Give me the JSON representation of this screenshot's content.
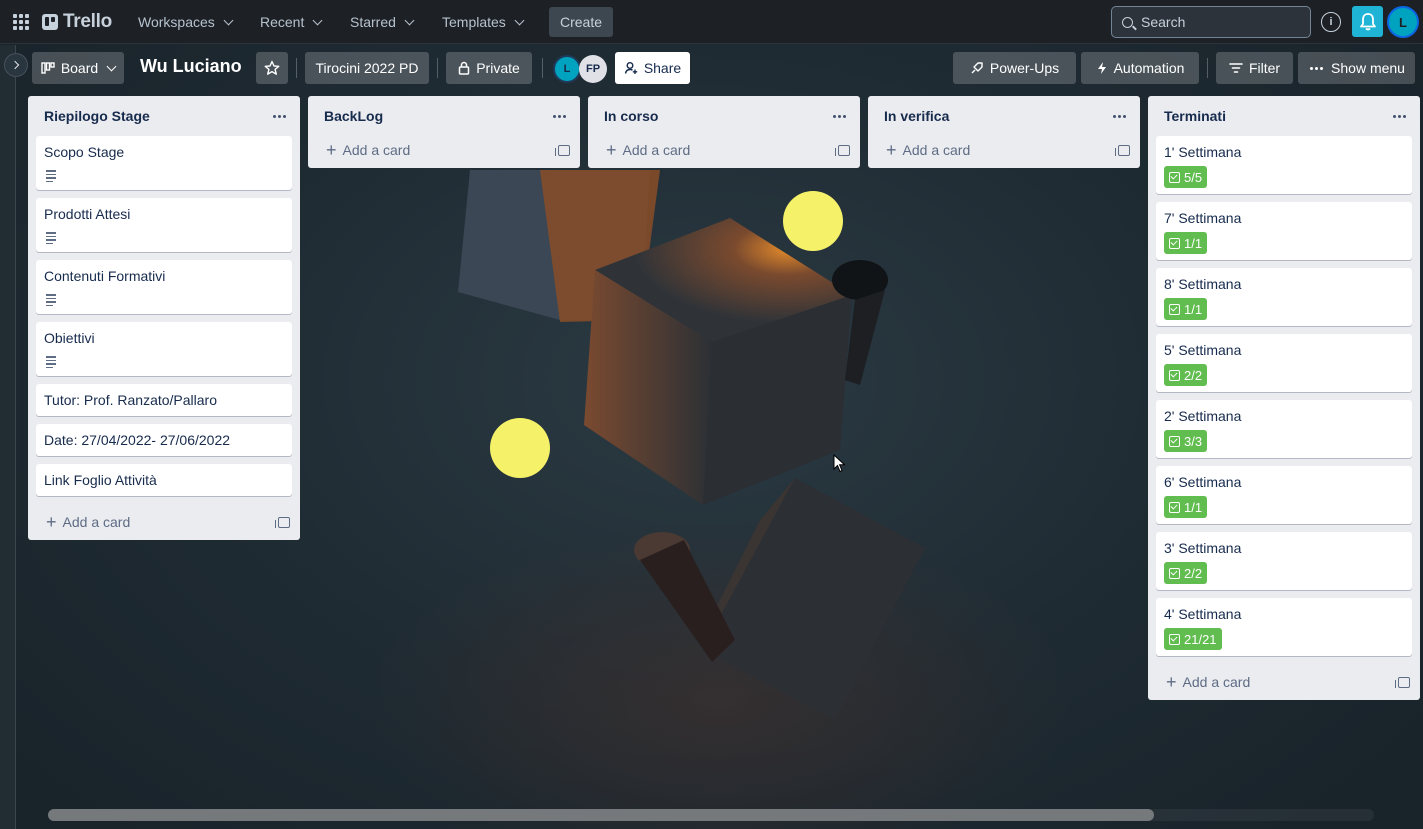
{
  "topnav": {
    "brand": "Trello",
    "menus": [
      "Workspaces",
      "Recent",
      "Starred",
      "Templates"
    ],
    "create_label": "Create",
    "search_placeholder": "Search",
    "info_glyph": "i",
    "avatar_initial": "L",
    "icons": [
      "apps-grid-icon",
      "trello-logo-icon",
      "search-icon",
      "info-icon",
      "bell-icon"
    ]
  },
  "board": {
    "view_label": "Board",
    "title": "Wu Luciano",
    "workspace_label": "Tirocini 2022 PD",
    "visibility_label": "Private",
    "members": [
      {
        "initials": "L",
        "color": "#00a3bf"
      },
      {
        "initials": "FP",
        "color": "#dfe1e6"
      }
    ],
    "share_label": "Share",
    "powerups_label": "Power-Ups",
    "automation_label": "Automation",
    "filter_label": "Filter",
    "show_menu_label": "Show menu"
  },
  "lists": [
    {
      "title": "Riepilogo Stage",
      "cards": [
        {
          "title": "Scopo Stage",
          "has_description": true
        },
        {
          "title": "Prodotti Attesi",
          "has_description": true
        },
        {
          "title": "Contenuti Formativi",
          "has_description": true
        },
        {
          "title": "Obiettivi",
          "has_description": true
        },
        {
          "title": "Tutor: Prof. Ranzato/Pallaro"
        },
        {
          "title": "Date: 27/04/2022- 27/06/2022"
        },
        {
          "title": "Link Foglio Attività"
        }
      ],
      "add_label": "Add a card"
    },
    {
      "title": "BackLog",
      "cards": [],
      "add_label": "Add a card"
    },
    {
      "title": "In corso",
      "cards": [],
      "add_label": "Add a card"
    },
    {
      "title": "In verifica",
      "cards": [],
      "add_label": "Add a card"
    },
    {
      "title": "Terminati",
      "cards": [
        {
          "title": "1' Settimana",
          "checklist": "5/5"
        },
        {
          "title": "7' Settimana",
          "checklist": "1/1"
        },
        {
          "title": "8' Settimana",
          "checklist": "1/1"
        },
        {
          "title": "5' Settimana",
          "checklist": "2/2"
        },
        {
          "title": "2' Settimana",
          "checklist": "3/3"
        },
        {
          "title": "6' Settimana",
          "checklist": "1/1"
        },
        {
          "title": "3' Settimana",
          "checklist": "2/2"
        },
        {
          "title": "4' Settimana",
          "checklist": "21/21"
        }
      ],
      "add_label": "Add a card"
    }
  ],
  "colors": {
    "nav_bg": "#1d2125",
    "list_bg": "#ebecf0",
    "checklist_complete": "#61bd4f",
    "notification_accent": "#1fb3d6"
  }
}
